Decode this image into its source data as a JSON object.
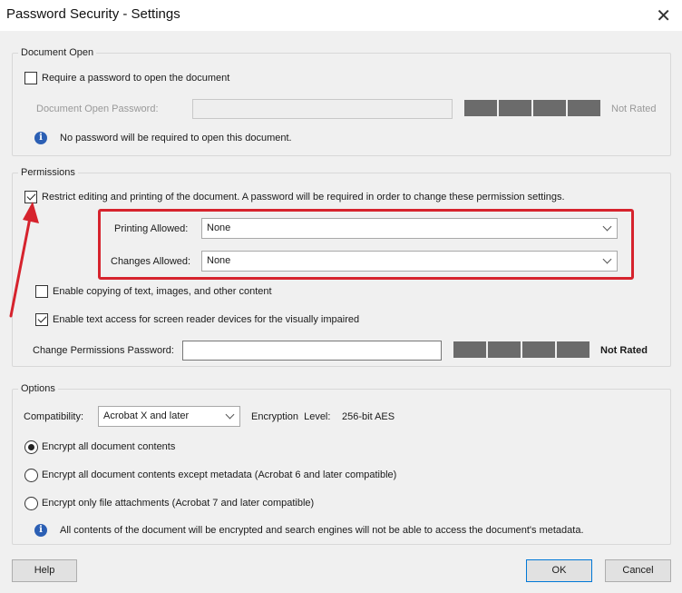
{
  "window": {
    "title": "Password Security - Settings",
    "close_glyph": "✕"
  },
  "document_open": {
    "legend": "Document Open",
    "require_password_label": "Require a password to open the document",
    "require_password_checked": false,
    "password_field_label": "Document Open Password:",
    "password_value": "",
    "strength_text": "Not Rated",
    "info_text": "No password will be required to open this document."
  },
  "permissions": {
    "legend": "Permissions",
    "restrict_label": "Restrict editing and printing of the document. A password will be required in order to change these permission settings.",
    "restrict_checked": true,
    "printing_label": "Printing Allowed:",
    "printing_value": "None",
    "changes_label": "Changes Allowed:",
    "changes_value": "None",
    "copy_label": "Enable copying of text, images, and other content",
    "copy_checked": false,
    "screen_reader_label": "Enable text access for screen reader devices for the visually impaired",
    "screen_reader_checked": true,
    "change_pw_label": "Change Permissions Password:",
    "change_pw_value": "",
    "strength_text": "Not Rated"
  },
  "options": {
    "legend": "Options",
    "compatibility_label": "Compatibility:",
    "compatibility_value": "Acrobat X and later",
    "encryption_label": "Encryption  Level:",
    "encryption_value": "256-bit AES",
    "radio_all": "Encrypt all document contents",
    "radio_except_metadata": "Encrypt all document contents except metadata (Acrobat 6 and later compatible)",
    "radio_attachments": "Encrypt only file attachments (Acrobat 7 and later compatible)",
    "selected_radio": "radio_all",
    "info_text": "All contents of the document will be encrypted and search engines will not be able to access the document's metadata."
  },
  "buttons": {
    "help": "Help",
    "ok": "OK",
    "cancel": "Cancel"
  },
  "annotation": {
    "highlight_color": "#d6232d"
  },
  "icons": {
    "info": "information-icon",
    "chevron": "chevron-down-icon",
    "close": "close-icon",
    "arrow": "red-arrow-annotation-icon",
    "info_glyph": "i"
  }
}
